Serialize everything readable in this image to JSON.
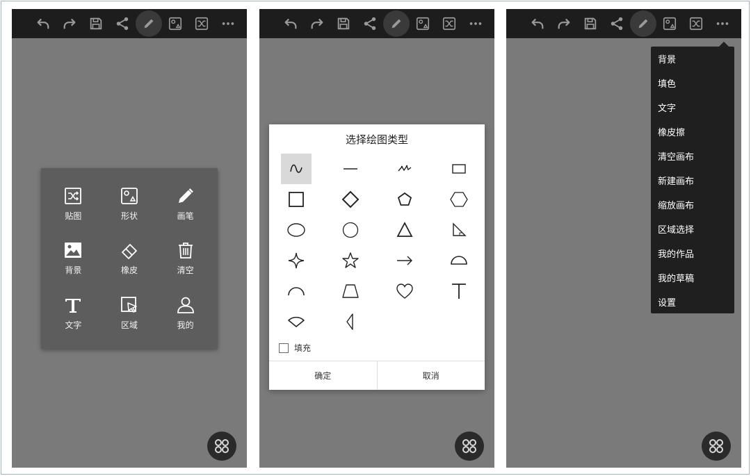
{
  "toolbar_icons": [
    "undo-icon",
    "redo-icon",
    "save-icon",
    "share-icon",
    "pencil-icon",
    "shape-icon",
    "shuffle-icon",
    "more-icon"
  ],
  "phone1": {
    "menu": [
      {
        "label": "贴图",
        "icon": "sticker-icon"
      },
      {
        "label": "形状",
        "icon": "shape-icon"
      },
      {
        "label": "画笔",
        "icon": "pencil-icon"
      },
      {
        "label": "背景",
        "icon": "image-icon"
      },
      {
        "label": "橡皮",
        "icon": "eraser-icon"
      },
      {
        "label": "清空",
        "icon": "trash-icon"
      },
      {
        "label": "文字",
        "icon": "text-icon"
      },
      {
        "label": "区域",
        "icon": "region-select-icon"
      },
      {
        "label": "我的",
        "icon": "user-icon"
      }
    ]
  },
  "phone2": {
    "dialog": {
      "title": "选择绘图类型",
      "fill_label": "填充",
      "fill_checked": false,
      "confirm": "确定",
      "cancel": "取消",
      "shapes": [
        "freehand",
        "line",
        "polyline",
        "rect-thin",
        "square",
        "diamond",
        "pentagon",
        "hexagon",
        "ellipse",
        "circle",
        "triangle",
        "right-triangle",
        "sparkle",
        "star",
        "arrow",
        "semicircle",
        "arc",
        "trapezoid",
        "heart",
        "t-shape",
        "fan",
        "half-leaf"
      ],
      "selected_index": 0
    }
  },
  "phone3": {
    "menu": [
      "背景",
      "填色",
      "文字",
      "橡皮擦",
      "清空画布",
      "新建画布",
      "缩放画布",
      "区域选择",
      "我的作品",
      "我的草稿",
      "设置"
    ]
  },
  "colors": {
    "canvas": "#7a7a7a",
    "toolbar": "#1d1d1d",
    "menu_panel": "#5d5d5d",
    "dropdown": "#1f1f1f",
    "dialog": "#ffffff"
  }
}
